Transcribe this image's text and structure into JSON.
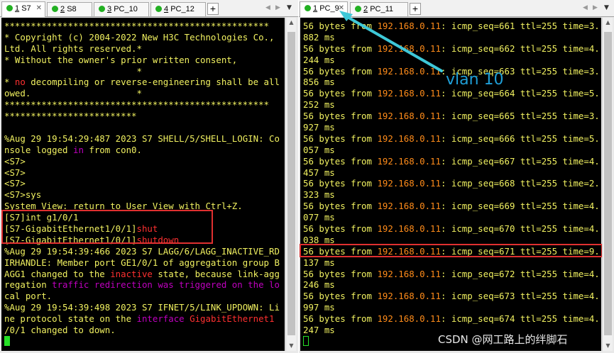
{
  "left_tabs": [
    {
      "num": "1",
      "label": "S7",
      "active": true
    },
    {
      "num": "2",
      "label": "S8",
      "active": false
    },
    {
      "num": "3",
      "label": "PC_10",
      "active": false
    },
    {
      "num": "4",
      "label": "PC_12",
      "active": false
    }
  ],
  "right_tabs": [
    {
      "num": "1",
      "label": "PC_9",
      "active": true
    },
    {
      "num": "2",
      "label": "PC_11",
      "active": false
    }
  ],
  "plus_label": "+",
  "left_terminal": [
    [
      {
        "t": "**************************************************"
      }
    ],
    [
      {
        "t": "* Copyright (c) 2004-2022 New H3C Technologies Co.,"
      }
    ],
    [
      {
        "t": "Ltd. All rights reserved.*"
      }
    ],
    [
      {
        "t": "* Without the owner's prior written consent,"
      }
    ],
    [
      {
        "t": "                         *"
      }
    ],
    [
      {
        "t": "* "
      },
      {
        "t": "no",
        "c": "red"
      },
      {
        "t": " decompiling or reverse-engineering shall be all"
      }
    ],
    [
      {
        "t": "owed.                    *"
      }
    ],
    [
      {
        "t": "**************************************************"
      }
    ],
    [
      {
        "t": "*************************"
      }
    ],
    [
      {
        "t": ""
      }
    ],
    [
      {
        "t": "%Aug 29 19:54:29:487 2023 S7 SHELL/5/SHELL_LOGIN: Co"
      }
    ],
    [
      {
        "t": "nsole logged "
      },
      {
        "t": "in",
        "c": "mag"
      },
      {
        "t": " from con0."
      }
    ],
    [
      {
        "t": "<S7>"
      }
    ],
    [
      {
        "t": "<S7>"
      }
    ],
    [
      {
        "t": "<S7>"
      }
    ],
    [
      {
        "t": "<S7>sys"
      }
    ],
    [
      {
        "t": "System View: return to User View with Ctrl+Z."
      }
    ],
    [
      {
        "t": "[S7]int g1/0/1"
      }
    ],
    [
      {
        "t": "[S7-GigabitEthernet1/0/1]"
      },
      {
        "t": "shut",
        "c": "red"
      }
    ],
    [
      {
        "t": "[S7-GigabitEthernet1/0/1]"
      },
      {
        "t": "shutdown",
        "c": "red"
      }
    ],
    [
      {
        "t": "%Aug 29 19:54:39:466 2023 S7 LAGG/6/LAGG_INACTIVE_RD"
      }
    ],
    [
      {
        "t": "IRHANDLE: Member port GE1/0/1 of aggregation group B"
      }
    ],
    [
      {
        "t": "AGG1 changed to the "
      },
      {
        "t": "inactive",
        "c": "red"
      },
      {
        "t": " state, because link-agg"
      }
    ],
    [
      {
        "t": "regation "
      },
      {
        "t": "traffic redirection was triggered on the lo",
        "c": "mag"
      }
    ],
    [
      {
        "t": "cal port."
      }
    ],
    [
      {
        "t": "%Aug 29 19:54:39:498 2023 S7 IFNET/5/LINK_UPDOWN: Li"
      }
    ],
    [
      {
        "t": "ne protocol state on the "
      },
      {
        "t": "interface",
        "c": "mag"
      },
      {
        "t": " "
      },
      {
        "t": "GigabitEthernet1",
        "c": "red"
      }
    ],
    [
      {
        "t": "/0/1 changed to down."
      }
    ]
  ],
  "right_terminal": [
    [
      {
        "t": "56 bytes from "
      },
      {
        "t": "192.168.0.11",
        "c": "ora"
      },
      {
        "t": ": icmp_seq=661 ttl=255 time=3."
      }
    ],
    [
      {
        "t": "882 ms"
      }
    ],
    [
      {
        "t": "56 bytes from "
      },
      {
        "t": "192.168.0.11",
        "c": "ora"
      },
      {
        "t": ": icmp_seq=662 ttl=255 time=4."
      }
    ],
    [
      {
        "t": "244 ms"
      }
    ],
    [
      {
        "t": "56 bytes from "
      },
      {
        "t": "192.168.0.11",
        "c": "ora"
      },
      {
        "t": ": icmp_seq=663 ttl=255 time=3."
      }
    ],
    [
      {
        "t": "856 ms"
      }
    ],
    [
      {
        "t": "56 bytes from "
      },
      {
        "t": "192.168.0.11",
        "c": "ora"
      },
      {
        "t": ": icmp_seq=664 ttl=255 time=5."
      }
    ],
    [
      {
        "t": "252 ms"
      }
    ],
    [
      {
        "t": "56 bytes from "
      },
      {
        "t": "192.168.0.11",
        "c": "ora"
      },
      {
        "t": ": icmp_seq=665 ttl=255 time=3."
      }
    ],
    [
      {
        "t": "927 ms"
      }
    ],
    [
      {
        "t": "56 bytes from "
      },
      {
        "t": "192.168.0.11",
        "c": "ora"
      },
      {
        "t": ": icmp_seq=666 ttl=255 time=5."
      }
    ],
    [
      {
        "t": "057 ms"
      }
    ],
    [
      {
        "t": "56 bytes from "
      },
      {
        "t": "192.168.0.11",
        "c": "ora"
      },
      {
        "t": ": icmp_seq=667 ttl=255 time=4."
      }
    ],
    [
      {
        "t": "457 ms"
      }
    ],
    [
      {
        "t": "56 bytes from "
      },
      {
        "t": "192.168.0.11",
        "c": "ora"
      },
      {
        "t": ": icmp_seq=668 ttl=255 time=2."
      }
    ],
    [
      {
        "t": "323 ms"
      }
    ],
    [
      {
        "t": "56 bytes from "
      },
      {
        "t": "192.168.0.11",
        "c": "ora"
      },
      {
        "t": ": icmp_seq=669 ttl=255 time=4."
      }
    ],
    [
      {
        "t": "077 ms"
      }
    ],
    [
      {
        "t": "56 bytes from "
      },
      {
        "t": "192.168.0.11",
        "c": "ora"
      },
      {
        "t": ": icmp_seq=670 ttl=255 time=4."
      }
    ],
    [
      {
        "t": "038 ms"
      }
    ],
    [
      {
        "t": "56 bytes from "
      },
      {
        "t": "192.168.0.11",
        "c": "ora"
      },
      {
        "t": ": icmp_seq=671 ttl=255 time=9."
      }
    ],
    [
      {
        "t": "137 ms"
      }
    ],
    [
      {
        "t": "56 bytes from "
      },
      {
        "t": "192.168.0.11",
        "c": "ora"
      },
      {
        "t": ": icmp_seq=672 ttl=255 time=4."
      }
    ],
    [
      {
        "t": "246 ms"
      }
    ],
    [
      {
        "t": "56 bytes from "
      },
      {
        "t": "192.168.0.11",
        "c": "ora"
      },
      {
        "t": ": icmp_seq=673 ttl=255 time=4."
      }
    ],
    [
      {
        "t": "997 ms"
      }
    ],
    [
      {
        "t": "56 bytes from "
      },
      {
        "t": "192.168.0.11",
        "c": "ora"
      },
      {
        "t": ": icmp_seq=674 ttl=255 time=4."
      }
    ],
    [
      {
        "t": "247 ms"
      }
    ]
  ],
  "annotation": "vlan 10",
  "watermark": "CSDN @网工路上的绊脚石",
  "colors": {
    "terminal_bg": "#000000",
    "text": "#f1f160",
    "red": "#ff3030",
    "magenta": "#c000c0",
    "ip": "#ff8c1a",
    "annotation": "#1f9fd8",
    "highlight_box": "#e03030"
  }
}
